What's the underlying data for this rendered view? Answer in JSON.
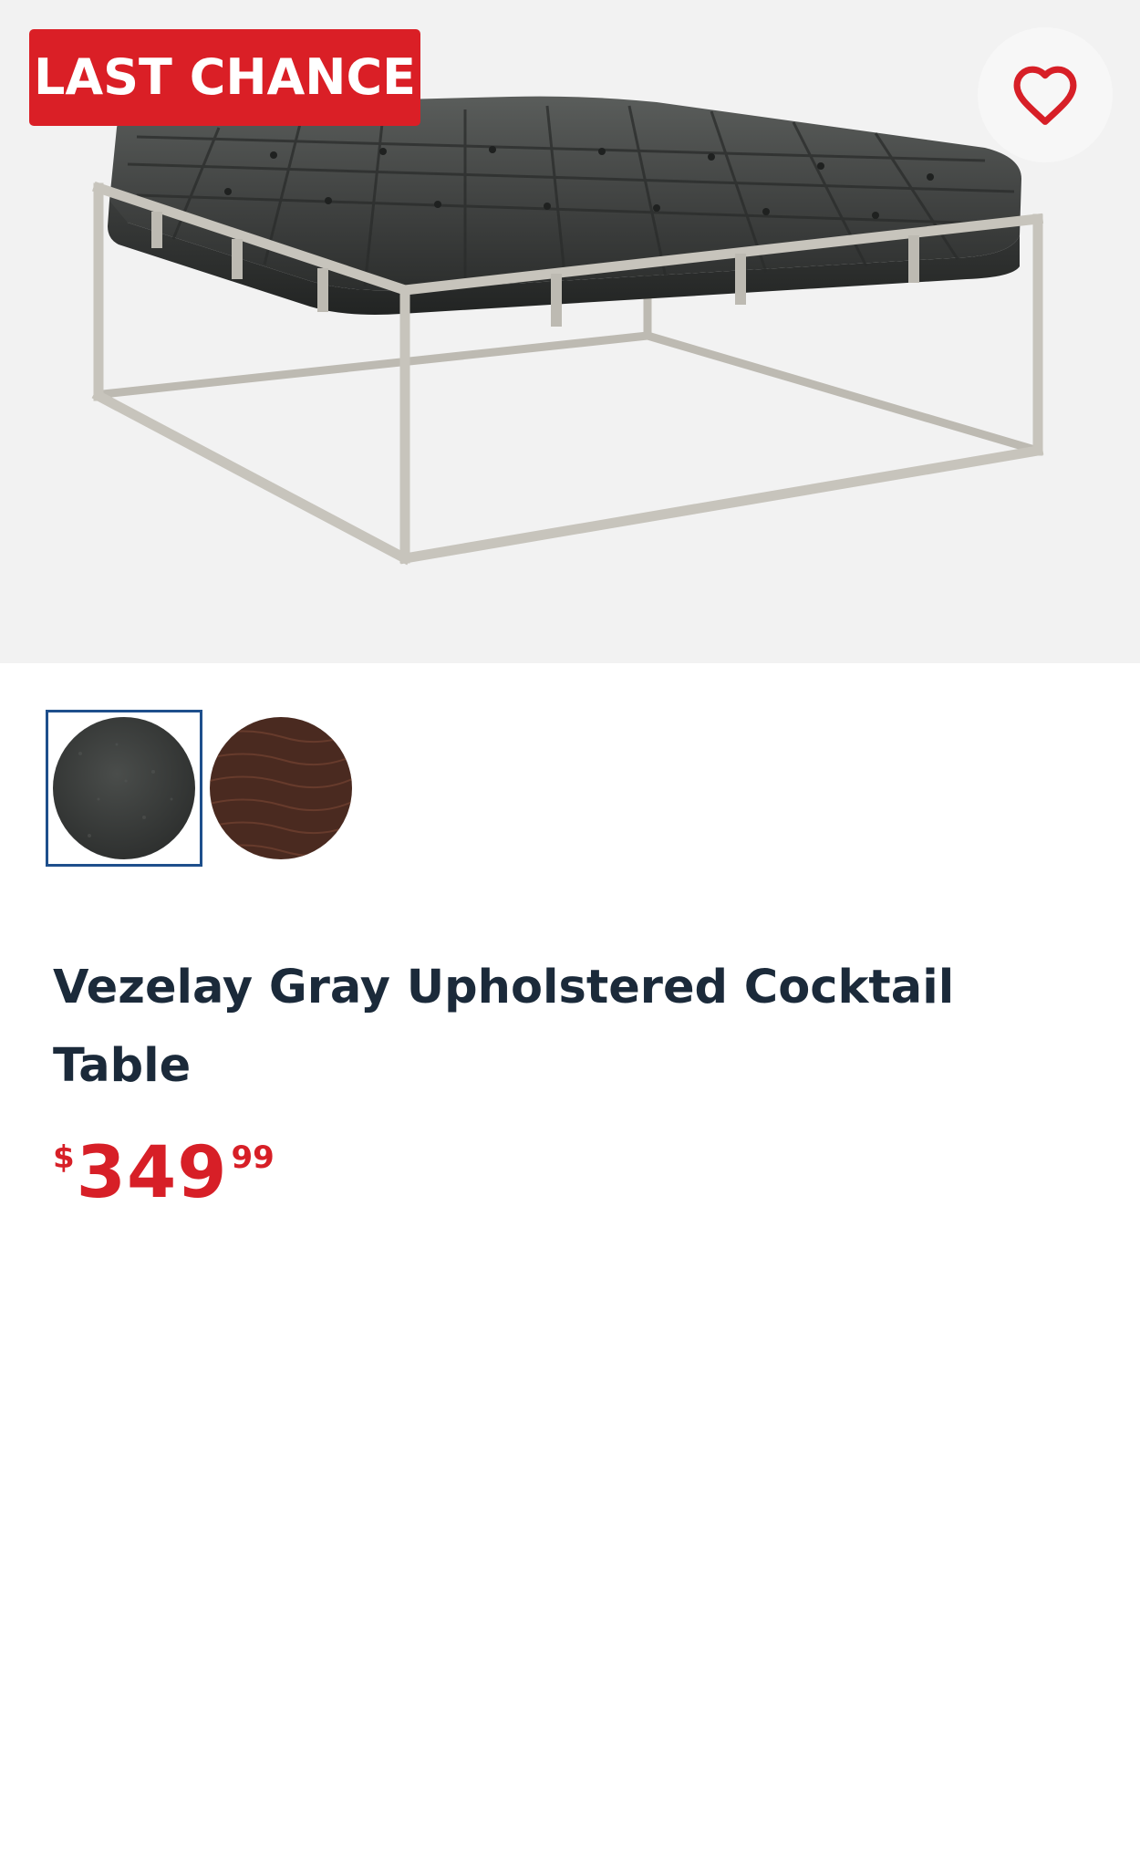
{
  "badge": {
    "label": "LAST CHANCE",
    "color": "#da1f26"
  },
  "favorite": {
    "icon": "heart-outline-icon",
    "color": "#d71f27"
  },
  "product": {
    "image_alt": "gray tufted upholstered cocktail table with silver metal frame",
    "swatches": [
      {
        "name": "Gray",
        "color": "#3a3d3b",
        "selected": true
      },
      {
        "name": "Brown",
        "color": "#4a2a20",
        "selected": false
      }
    ],
    "title": "Vezelay Gray Upholstered Cocktail Table",
    "price": {
      "currency": "$",
      "dollars": "349",
      "cents": "99",
      "color": "#d71f27"
    }
  }
}
